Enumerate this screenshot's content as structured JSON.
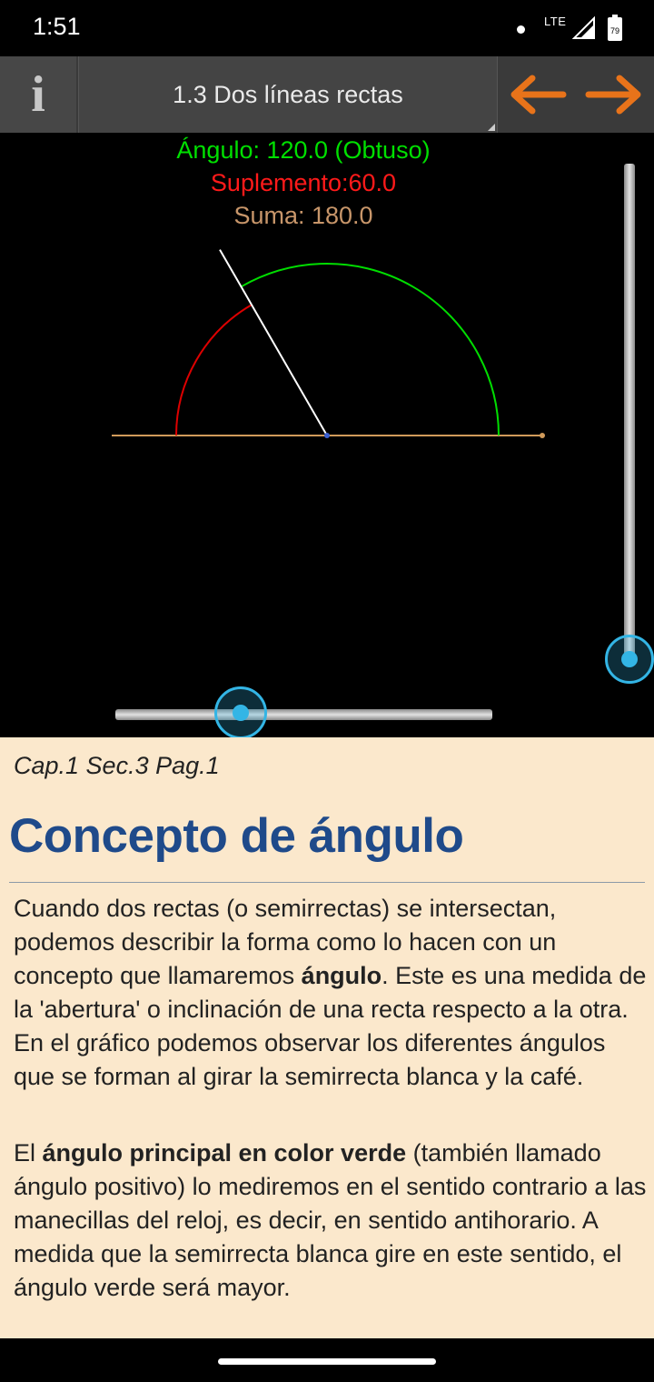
{
  "status_bar": {
    "time": "1:51",
    "network": "LTE",
    "battery_level": "79"
  },
  "app_bar": {
    "info_label": "i",
    "title": "1.3 Dos líneas rectas",
    "prev_icon": "arrow-left-icon",
    "next_icon": "arrow-right-icon",
    "arrow_color": "#e8731a"
  },
  "canvas": {
    "angle_label": "Ángulo: 120.0  (Obtuso)",
    "supplement_label": "Suplemento:60.0",
    "sum_label": "Suma: 180.0",
    "angle_degrees": 120.0,
    "supplement_degrees": 60.0,
    "colors": {
      "angle_arc": "#00dd00",
      "supplement_arc": "#dd0000",
      "white_ray": "#ffffff",
      "cafe_line": "#d09a5a",
      "vertex": "#3a5fd0"
    }
  },
  "sliders": {
    "vertical_level": 0.0,
    "horizontal_level": 0.33
  },
  "content": {
    "breadcrumb": "Cap.1 Sec.3 Pag.1",
    "heading": "Concepto de ángulo",
    "p1_a": "Cuando dos rectas (o semirrectas) se intersectan, podemos describir la forma como lo hacen con un concepto que llamaremos ",
    "p1_bold": "ángulo",
    "p1_b": ". Este es una medida de la 'abertura' o inclinación de una recta respecto a la otra. En el gráfico podemos observar los diferentes ángulos que se forman al girar la semirrecta blanca y la café.",
    "p2_a": "El ",
    "p2_bold": "ángulo principal en color verde",
    "p2_b": " (también llamado ángulo positivo) lo mediremos en el sentido contrario a las manecillas del reloj, es decir, en sentido antihorario. A medida que la semirrecta blanca gire en este sentido, el ángulo verde será mayor."
  }
}
